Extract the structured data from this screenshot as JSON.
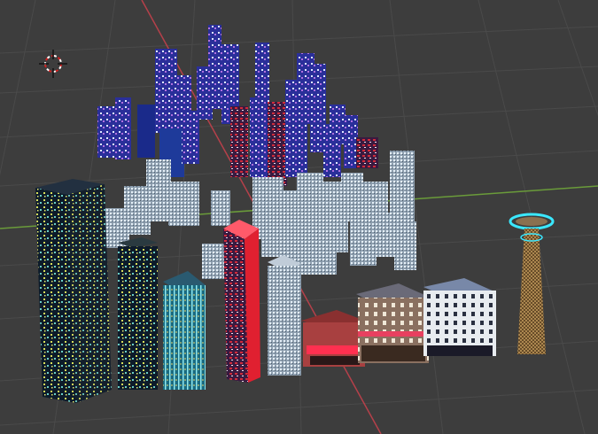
{
  "viewport": {
    "background": "#3d3d3d",
    "grid_color": "#4a4a4a",
    "x_axis_color": "#b5404a",
    "y_axis_color": "#6a9b3a"
  },
  "tools": {
    "cursor_icon": "3d-cursor-icon",
    "cursor_colors": [
      "#d02020",
      "#ffffff"
    ]
  },
  "scene": {
    "objects": [
      {
        "name": "blue-glass-tower-cluster",
        "icon": "building-icon"
      },
      {
        "name": "silver-tower-cluster",
        "icon": "building-icon"
      },
      {
        "name": "dark-skyscraper-yellow-windows",
        "icon": "building-icon"
      },
      {
        "name": "dark-skyscraper-small",
        "icon": "building-icon"
      },
      {
        "name": "cyan-glass-tower",
        "icon": "building-icon"
      },
      {
        "name": "neon-red-tower",
        "icon": "building-icon"
      },
      {
        "name": "silver-block-tower",
        "icon": "building-icon"
      },
      {
        "name": "red-shop-building",
        "icon": "shop-icon"
      },
      {
        "name": "brick-store-building",
        "icon": "shop-icon"
      },
      {
        "name": "white-office-building",
        "icon": "building-icon"
      },
      {
        "name": "observation-tower",
        "icon": "tower-icon"
      }
    ]
  }
}
